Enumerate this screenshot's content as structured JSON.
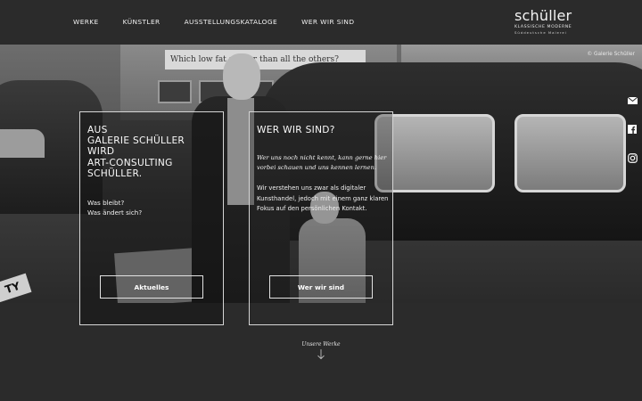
{
  "nav": {
    "items": [
      "WERKE",
      "KÜNSTLER",
      "AUSSTELLUNGSKATALOGE",
      "WER WIR SIND"
    ]
  },
  "logo": {
    "name": "schüller",
    "line1": "KLASSISCHE MODERNE",
    "line2": "Süddeutsche Malerei"
  },
  "hero": {
    "bus_ad": "Which low fat sp... er than all the others?",
    "plate": "TY",
    "copyright": "© Galerie Schüller"
  },
  "social": {
    "icons": [
      "mail-icon",
      "facebook-icon",
      "instagram-icon"
    ]
  },
  "box_left": {
    "title": "AUS\nGALERIE SCHÜLLER\nWIRD\nART-CONSULTING\nSCHÜLLER.",
    "text": "Was bleibt?\nWas ändert sich?",
    "button": "Aktuelles"
  },
  "box_right": {
    "title": "WER WIR SIND?",
    "serif": "Wer uns noch nicht kennt, kann gerne hier vorbei schauen und uns kennen lernen.",
    "body": "Wir verstehen uns zwar als digitaler Kunsthandel, jedoch mit einem ganz klaren Fokus auf den persönlichen Kontakt.",
    "button": "Wer wir sind"
  },
  "footer": {
    "more_label": "Unsere Werke"
  },
  "colors": {
    "background": "#2b2b2b",
    "text": "#ffffff",
    "border": "#d6d6d6"
  }
}
